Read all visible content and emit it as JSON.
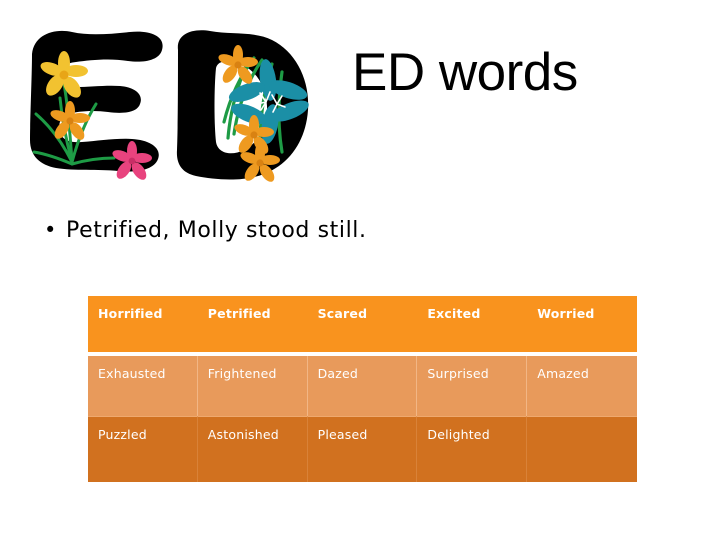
{
  "slide": {
    "title": "ED words",
    "logo_alt_text": "ED",
    "bullet_marker": "•",
    "bullet_text": "Petrified, Molly stood still."
  },
  "colors": {
    "header_orange": "#F9931E",
    "row_light_orange": "#E89A5B",
    "row_dark_orange": "#D1711F",
    "text_on_table": "#FFFFFF",
    "body_text": "#000000",
    "background": "#FFFFFF",
    "logo_letters": "#000000",
    "flower_teal": "#1B8FA6",
    "flower_yellow": "#F2C230",
    "flower_orange": "#EE9A20",
    "flower_pink": "#E8437E",
    "leaf_green": "#1E9B45"
  },
  "table": {
    "columns": 5,
    "headers": [
      "Horrified",
      "Petrified",
      "Scared",
      "Excited",
      "Worried"
    ],
    "rows": [
      [
        "Exhausted",
        "Frightened",
        "Dazed",
        "Surprised",
        "Amazed"
      ],
      [
        "Puzzled",
        "Astonished",
        "Pleased",
        "Delighted",
        ""
      ]
    ]
  }
}
